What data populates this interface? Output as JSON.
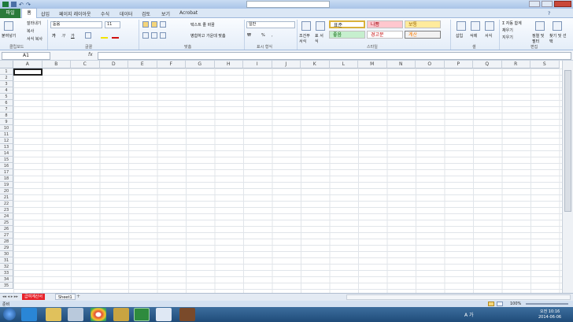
{
  "window": {
    "title_search_placeholder": ""
  },
  "tabs": {
    "file": "파일",
    "home": "홈",
    "insert": "삽입",
    "page_layout": "페이지 레이아웃",
    "formulas": "수식",
    "data": "데이터",
    "review": "검토",
    "view": "보기",
    "acrobat": "Acrobat"
  },
  "ribbon": {
    "clipboard": {
      "paste": "붙여넣기",
      "cut": "잘라내기",
      "copy": "복사",
      "format_painter": "서식 복사",
      "label": "클립보드"
    },
    "font": {
      "name": "돋움",
      "size": "11",
      "label": "글꼴"
    },
    "alignment": {
      "wrap_text": "텍스트 줄 바꿈",
      "merge_center": "병합하고 가운데 맞춤",
      "label": "맞춤"
    },
    "number": {
      "format": "일반",
      "label": "표시 형식"
    },
    "styles": {
      "conditional": "조건부 서식",
      "table": "표 서식",
      "normal": "표준",
      "bad": "나쁨",
      "neutral": "보통",
      "good": "좋음",
      "warning": "경고문",
      "calc": "계산",
      "label": "스타일"
    },
    "cells": {
      "insert": "삽입",
      "delete": "삭제",
      "format": "서식",
      "label": "셀"
    },
    "editing": {
      "autosum": "자동 합계",
      "fill": "채우기",
      "clear": "지우기",
      "sort_filter": "정렬 및 필터",
      "find_select": "찾기 및 선택",
      "label": "편집"
    }
  },
  "formula_bar": {
    "name_box": "A1",
    "fx": "fx",
    "value": ""
  },
  "columns": [
    "A",
    "B",
    "C",
    "D",
    "E",
    "F",
    "G",
    "H",
    "I",
    "J",
    "K",
    "L",
    "M",
    "N",
    "O",
    "P",
    "Q",
    "R",
    "S"
  ],
  "rows": [
    "1",
    "2",
    "3",
    "4",
    "5",
    "6",
    "7",
    "8",
    "9",
    "10",
    "11",
    "12",
    "13",
    "14",
    "15",
    "16",
    "17",
    "18",
    "19",
    "20",
    "21",
    "22",
    "23",
    "24",
    "25",
    "26",
    "27",
    "28",
    "29",
    "30",
    "31",
    "32",
    "33",
    "34",
    "35"
  ],
  "sheets": {
    "active": "급여계산서",
    "other": "Sheet1"
  },
  "status": {
    "mode": "준비",
    "zoom": "100%"
  },
  "taskbar": {
    "time": "오전 10:16",
    "date": "2014-06-06",
    "ime": "A 가"
  }
}
